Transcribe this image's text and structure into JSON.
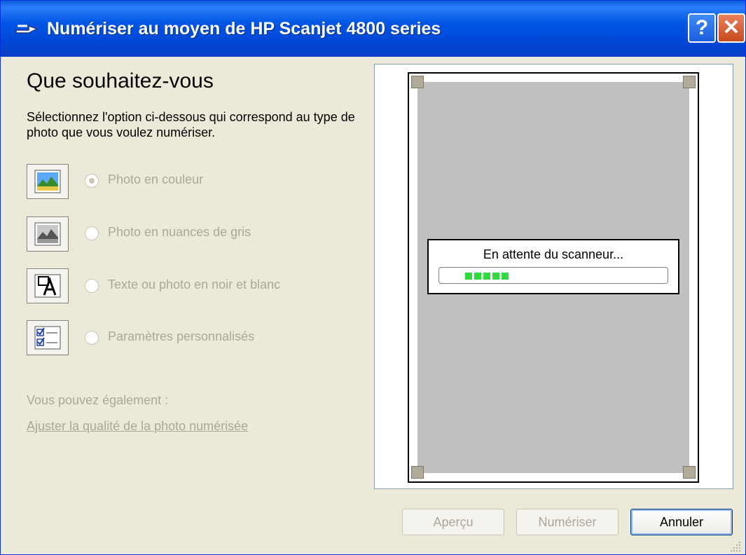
{
  "window": {
    "title": "Numériser au moyen de HP Scanjet 4800 series",
    "help_label": "?",
    "close_label": "✕",
    "titlebar_color": "#0055e5"
  },
  "main": {
    "heading": "Que souhaitez-vous",
    "description": "Sélectionnez l'option ci-dessous qui correspond au type de photo que vous voulez numériser.",
    "options": [
      {
        "label": "Photo en couleur",
        "selected": true,
        "icon": "color-photo-icon"
      },
      {
        "label": "Photo en nuances de gris",
        "selected": false,
        "icon": "grayscale-photo-icon"
      },
      {
        "label": "Texte ou photo en noir et blanc",
        "selected": false,
        "icon": "black-white-text-icon"
      },
      {
        "label": "Paramètres personnalisés",
        "selected": false,
        "icon": "custom-settings-icon"
      }
    ],
    "also_label": "Vous pouvez également :",
    "adjust_link": "Ajuster la qualité de la photo numérisée"
  },
  "preview": {
    "status": "En attente du scanneur...",
    "progress_segments": 5,
    "progress_color": "#2ddc3a"
  },
  "buttons": {
    "preview": "Aperçu",
    "scan": "Numériser",
    "cancel": "Annuler"
  }
}
